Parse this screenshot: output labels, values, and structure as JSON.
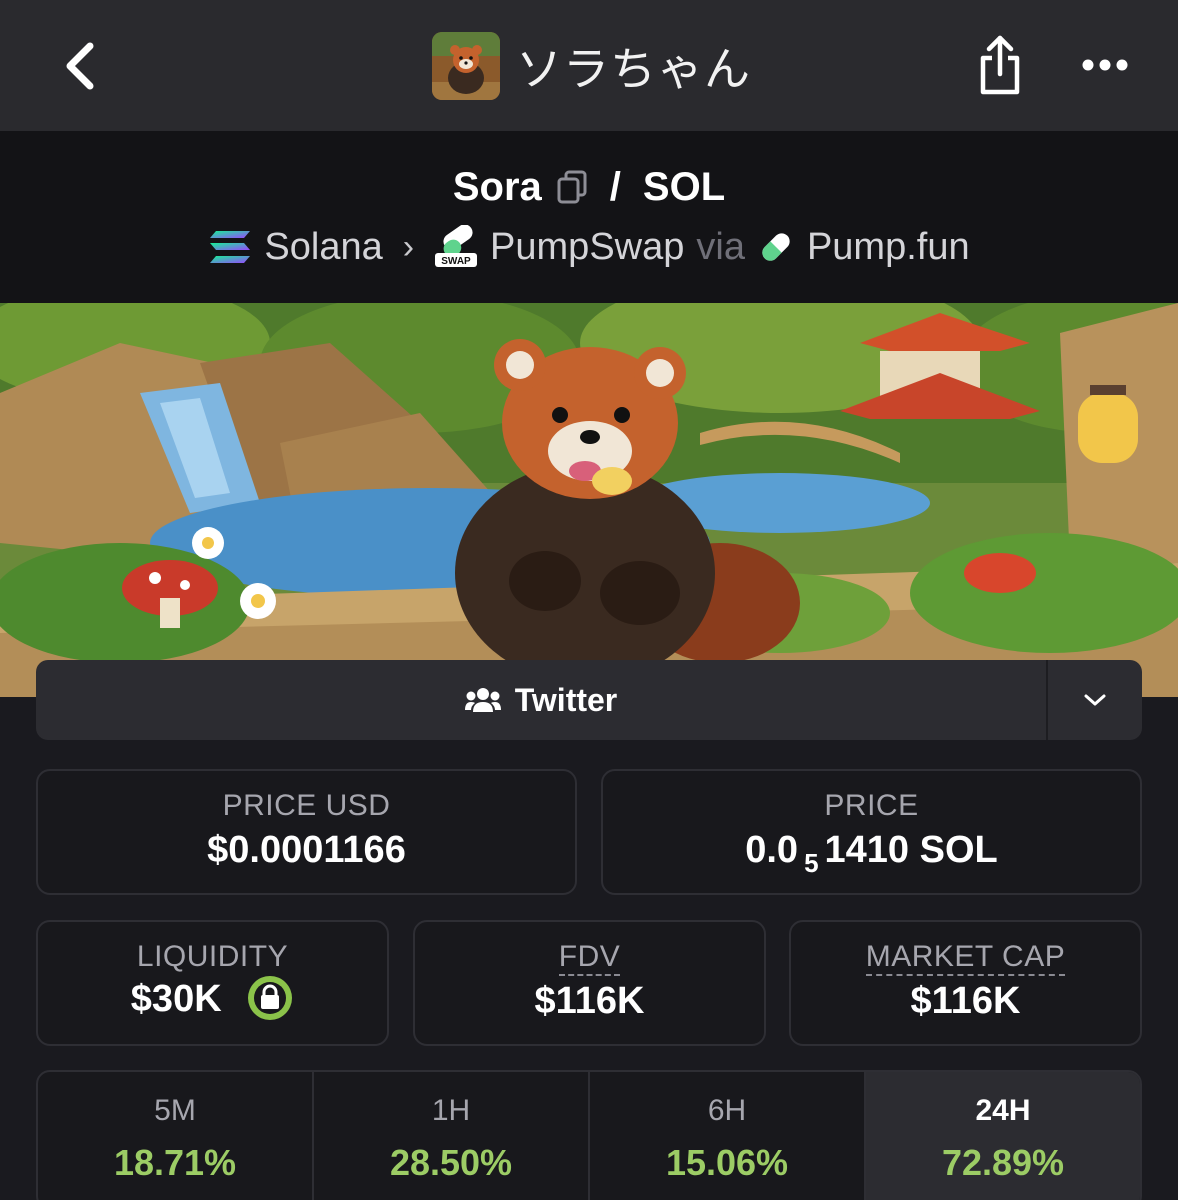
{
  "nav": {
    "title": "ソラちゃん"
  },
  "pair": {
    "base": "Sora",
    "separator": "/",
    "quote": "SOL",
    "chain": "Solana",
    "dex": "PumpSwap",
    "dex_badge": "SWAP",
    "via": "via",
    "launchpad": "Pump.fun"
  },
  "social": {
    "twitter_label": "Twitter"
  },
  "stats": {
    "price_usd_label": "PRICE USD",
    "price_usd_value": "$0.0001166",
    "price_label": "PRICE",
    "price_prefix": "0.0",
    "price_zeros": "5",
    "price_suffix": "1410 SOL",
    "liquidity_label": "LIQUIDITY",
    "liquidity_value": "$30K",
    "fdv_label": "FDV",
    "fdv_value": "$116K",
    "mcap_label": "MARKET CAP",
    "mcap_value": "$116K"
  },
  "timeframes": [
    {
      "label": "5M",
      "value": "18.71%"
    },
    {
      "label": "1H",
      "value": "28.50%"
    },
    {
      "label": "6H",
      "value": "15.06%"
    },
    {
      "label": "24H",
      "value": "72.89%"
    }
  ],
  "colors": {
    "positive": "#9ccc65",
    "lock": "#8bc34a"
  }
}
